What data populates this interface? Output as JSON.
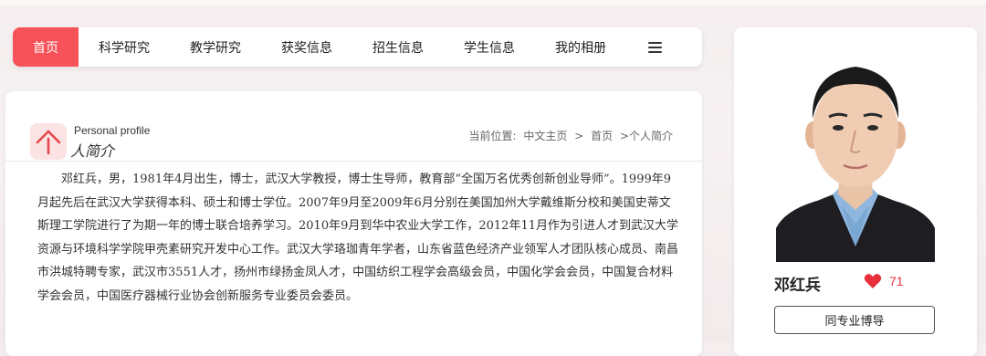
{
  "nav": {
    "items": [
      {
        "label": "首页",
        "active": true
      },
      {
        "label": "科学研究"
      },
      {
        "label": "教学研究"
      },
      {
        "label": "获奖信息"
      },
      {
        "label": "招生信息"
      },
      {
        "label": "学生信息"
      },
      {
        "label": "我的相册"
      }
    ],
    "menu_icon": "menu-icon"
  },
  "section": {
    "title_en": "Personal profile",
    "title_cn": "人简介",
    "icon": "person-icon"
  },
  "breadcrumb": {
    "prefix": "当前位置:",
    "items": [
      "中文主页",
      ">",
      "首页",
      ">个人简介"
    ]
  },
  "bio": "邓红兵，男，1981年4月出生，博士，武汉大学教授，博士生导师，教育部“全国万名优秀创新创业导师”。1999年9月起先后在武汉大学获得本科、硕士和博士学位。2007年9月至2009年6月分别在美国加州大学戴维斯分校和美国史蒂文斯理工学院进行了为期一年的博士联合培养学习。2010年9月到华中农业大学工作，2012年11月作为引进人才到武汉大学资源与环境科学学院甲壳素研究开发中心工作。武汉大学珞珈青年学者，山东省蓝色经济产业领军人才团队核心成员、南昌市洪城特聘专家，武汉市3551人才，扬州市绿扬金凤人才，中国纺织工程学会高级会员，中国化学会会员，中国复合材料学会会员，中国医疗器械行业协会创新服务专业委员会委员。",
  "card": {
    "name": "邓红兵",
    "likes": "71",
    "heart_color": "#e8303a",
    "button": "同专业博导"
  },
  "colors": {
    "accent": "#f7525a"
  }
}
